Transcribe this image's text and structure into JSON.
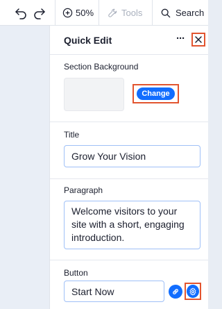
{
  "toolbar": {
    "undo_icon": "undo-icon",
    "redo_icon": "redo-icon",
    "zoom_label": "50%",
    "tools_label": "Tools",
    "search_label": "Search"
  },
  "panel": {
    "title": "Quick Edit",
    "more_label": "···",
    "background_label": "Section Background",
    "change_label": "Change",
    "title_label": "Title",
    "title_value": "Grow Your Vision",
    "paragraph_label": "Paragraph",
    "paragraph_value": "Welcome visitors to your site with a short, engaging introduction.",
    "button_label": "Button",
    "button_value": "Start Now"
  },
  "colors": {
    "accent": "#116dff",
    "highlight": "#e2542f",
    "input_border": "#9fc0f7"
  }
}
